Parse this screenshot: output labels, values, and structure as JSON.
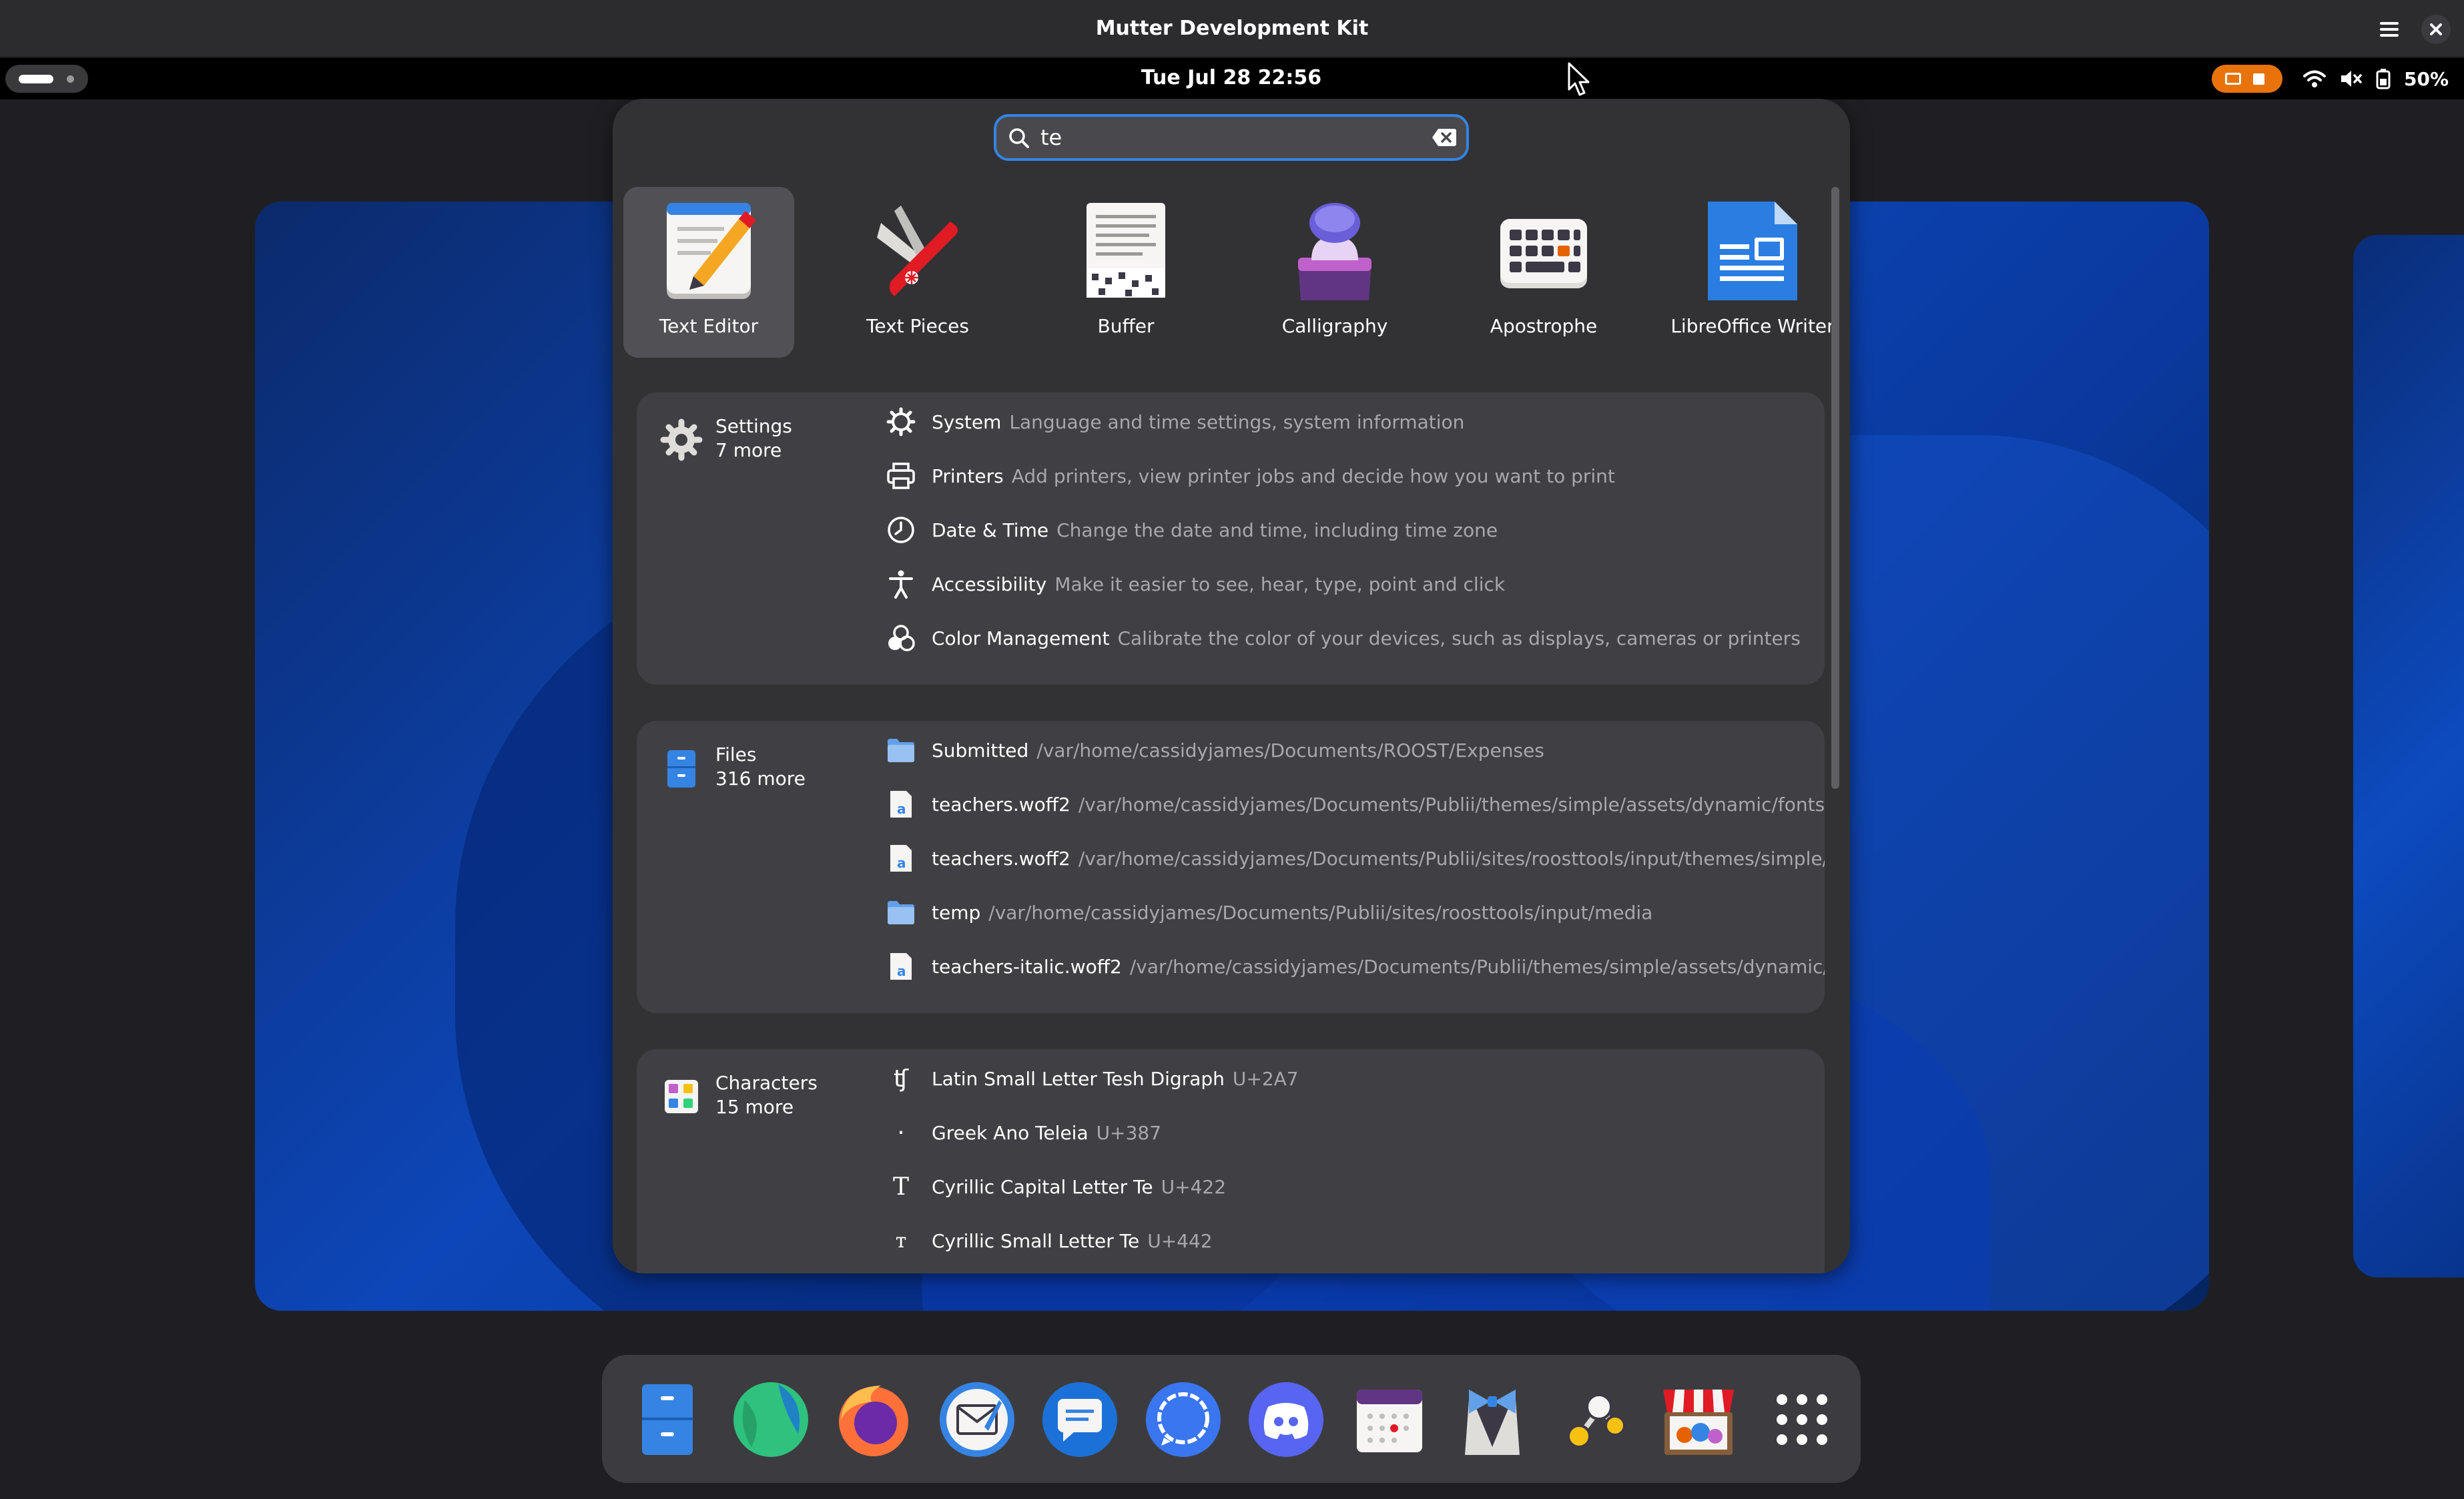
{
  "window": {
    "title": "Mutter Development Kit"
  },
  "topbar": {
    "clock": "Tue Jul 28  22:56",
    "battery": "50%"
  },
  "search": {
    "value": "te",
    "placeholder": ""
  },
  "apps": [
    {
      "name": "Text Editor",
      "icon": "text-editor-icon",
      "selected": true
    },
    {
      "name": "Text Pieces",
      "icon": "text-pieces-icon",
      "selected": false
    },
    {
      "name": "Buffer",
      "icon": "buffer-icon",
      "selected": false
    },
    {
      "name": "Calligraphy",
      "icon": "calligraphy-icon",
      "selected": false
    },
    {
      "name": "Apostrophe",
      "icon": "apostrophe-icon",
      "selected": false
    },
    {
      "name": "LibreOffice Writer",
      "icon": "libreoffice-writer-icon",
      "selected": false
    }
  ],
  "sections": {
    "settings": {
      "name": "Settings",
      "more": "7 more",
      "results": [
        {
          "title": "System",
          "desc": "Language and time settings, system information",
          "icon": "gear-icon"
        },
        {
          "title": "Printers",
          "desc": "Add printers, view printer jobs and decide how you want to print",
          "icon": "printer-icon"
        },
        {
          "title": "Date & Time",
          "desc": "Change the date and time, including time zone",
          "icon": "clock-icon"
        },
        {
          "title": "Accessibility",
          "desc": "Make it easier to see, hear, type, point and click",
          "icon": "accessibility-icon"
        },
        {
          "title": "Color Management",
          "desc": "Calibrate the color of your devices, such as displays, cameras or printers",
          "icon": "color-management-icon"
        }
      ]
    },
    "files": {
      "name": "Files",
      "more": "316 more",
      "results": [
        {
          "title": "Submitted",
          "desc": "/var/home/cassidyjames/Documents/ROOST/Expenses",
          "icon": "folder-icon"
        },
        {
          "title": "teachers.woff2",
          "desc": "/var/home/cassidyjames/Documents/Publii/themes/simple/assets/dynamic/fonts/t...",
          "icon": "font-file-icon"
        },
        {
          "title": "teachers.woff2",
          "desc": "/var/home/cassidyjames/Documents/Publii/sites/roosttools/input/themes/simple/a...",
          "icon": "font-file-icon"
        },
        {
          "title": "temp",
          "desc": "/var/home/cassidyjames/Documents/Publii/sites/roosttools/input/media",
          "icon": "folder-icon"
        },
        {
          "title": "teachers-italic.woff2",
          "desc": "/var/home/cassidyjames/Documents/Publii/themes/simple/assets/dynamic/f...",
          "icon": "font-file-icon"
        }
      ]
    },
    "characters": {
      "name": "Characters",
      "more": "15 more",
      "results": [
        {
          "glyph": "ʧ",
          "title": "Latin Small Letter Tesh Digraph",
          "desc": "U+2A7"
        },
        {
          "glyph": "·",
          "title": "Greek Ano Teleia",
          "desc": "U+387"
        },
        {
          "glyph": "Т",
          "title": "Cyrillic Capital Letter Te",
          "desc": "U+422"
        },
        {
          "glyph": "т",
          "title": "Cyrillic Small Letter Te",
          "desc": "U+442"
        }
      ]
    }
  },
  "dock": [
    "files-icon",
    "web-browser-icon",
    "firefox-icon",
    "mail-icon",
    "chat-icon",
    "signal-icon",
    "discord-icon",
    "calendar-icon",
    "tuxedo-icon",
    "network-icon",
    "software-store-icon",
    "app-grid-icon"
  ],
  "colors": {
    "accent": "#3584e4",
    "overlay_bg": "#323235",
    "section_bg": "#404044",
    "cast_indicator": "#e8730a"
  }
}
